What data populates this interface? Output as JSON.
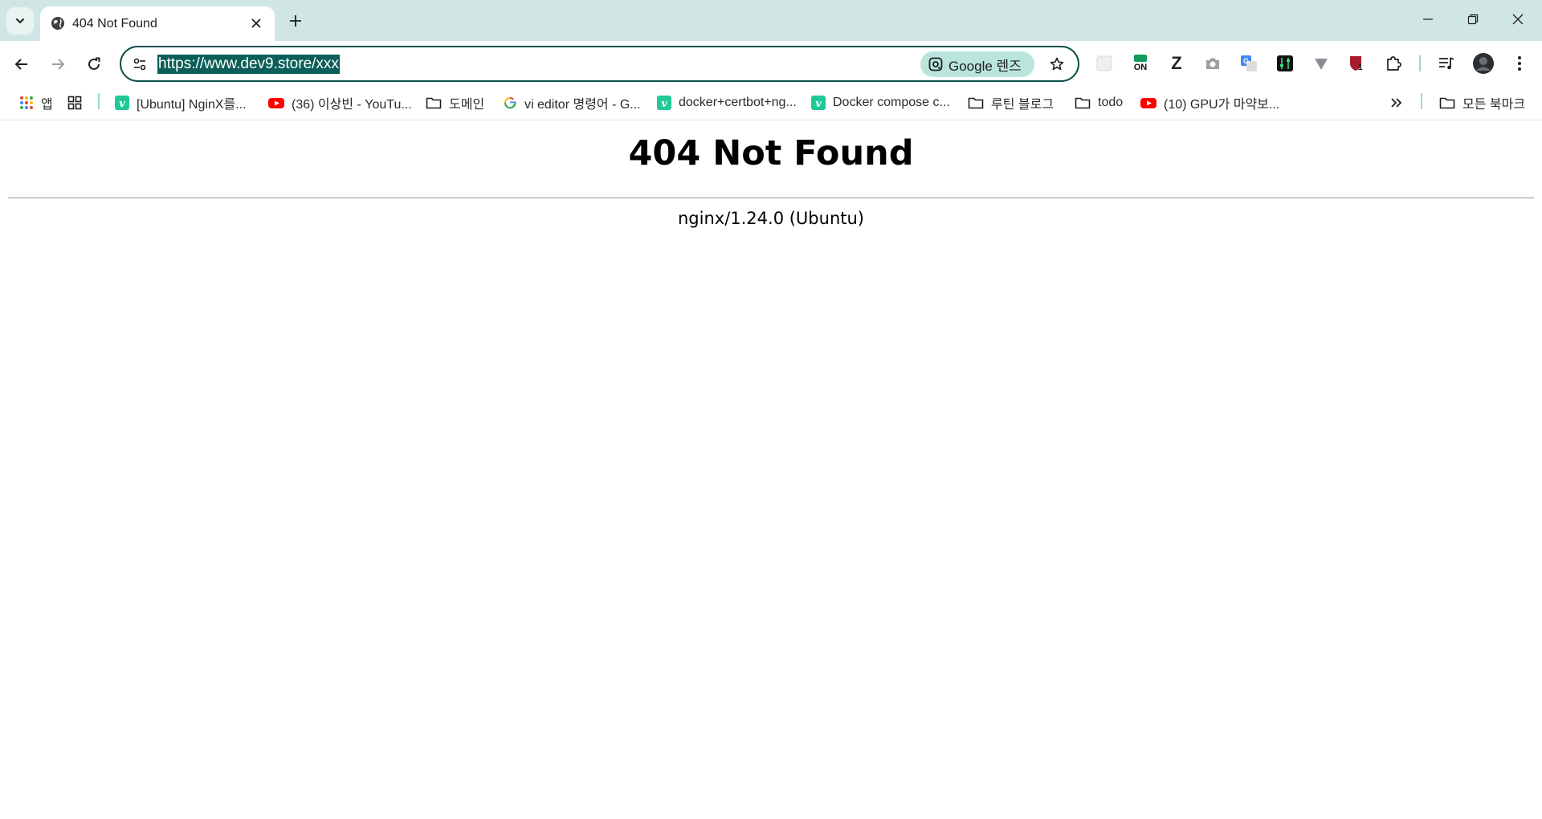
{
  "browser": {
    "tab": {
      "title": "404 Not Found"
    },
    "address_bar": {
      "url": "https://www.dev9.store/xxx",
      "lens_label": "Google 렌즈"
    },
    "extensions": [
      "ext-blank-icon",
      "on-badge-icon",
      "z-icon",
      "camera-icon",
      "translate-icon",
      "equalizer-icon",
      "v-icon",
      "shield-icon",
      "puzzle-icon"
    ],
    "extension_badges": {
      "on": "ON",
      "z": "Z",
      "shield_count": "1"
    },
    "bookmarks": {
      "apps_label": "앱",
      "items": [
        {
          "label": "[Ubuntu] NginX를...",
          "icon": "velog-icon"
        },
        {
          "label": "(36) 이상빈 - YouTu...",
          "icon": "youtube-icon"
        },
        {
          "label": "도메인",
          "icon": "folder-icon"
        },
        {
          "label": "vi editor 명령어 - G...",
          "icon": "google-icon"
        },
        {
          "label": "docker+certbot+ng...",
          "icon": "velog-icon"
        },
        {
          "label": "Docker compose c...",
          "icon": "velog-icon"
        },
        {
          "label": "루틴 블로그",
          "icon": "folder-icon"
        },
        {
          "label": "todo",
          "icon": "folder-icon"
        },
        {
          "label": "(10) GPU가 마약보...",
          "icon": "youtube-icon"
        }
      ],
      "all_bookmarks_label": "모든 북마크"
    },
    "colors": {
      "tabstrip": "#cfe6e4",
      "accent": "#0b5f58",
      "velog": "#20c997",
      "youtube": "#ff0000"
    }
  },
  "page": {
    "heading": "404 Not Found",
    "server": "nginx/1.24.0 (Ubuntu)"
  }
}
